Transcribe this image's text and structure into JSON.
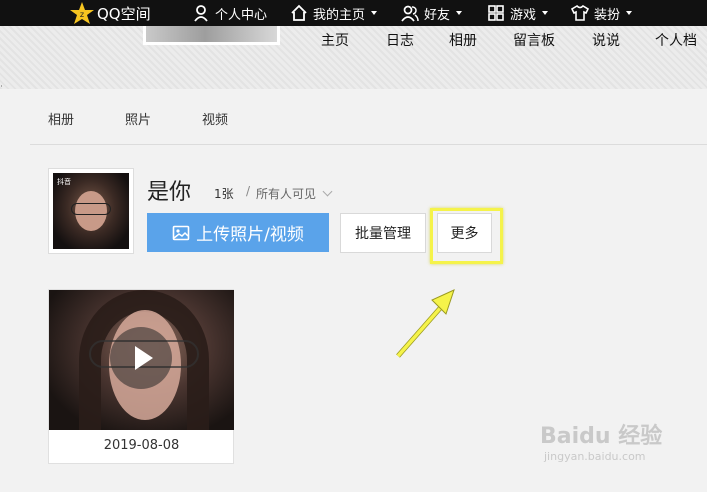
{
  "topbar": {
    "logo_text": "QQ空间",
    "nav": [
      {
        "label": "个人中心",
        "icon": "person-icon"
      },
      {
        "label": "我的主页",
        "icon": "home-icon",
        "has_dropdown": true
      },
      {
        "label": "好友",
        "icon": "friends-icon",
        "has_dropdown": true
      },
      {
        "label": "游戏",
        "icon": "grid-icon",
        "has_dropdown": true
      },
      {
        "label": "装扮",
        "icon": "shirt-icon",
        "has_dropdown": true
      }
    ]
  },
  "space_nav": [
    "主页",
    "日志",
    "相册",
    "留言板",
    "说说",
    "个人档"
  ],
  "edge_char": "ᐧ",
  "album_tabs": [
    "相册",
    "照片",
    "视频"
  ],
  "album": {
    "title": "是你",
    "count": "1张",
    "separator": "/",
    "privacy": "所有人可见",
    "cover_tag": "抖音"
  },
  "buttons": {
    "upload": "上传照片/视频",
    "batch": "批量管理",
    "more": "更多"
  },
  "video": {
    "date": "2019-08-08"
  },
  "watermark": {
    "logo": "Baidu 经验",
    "url": "jingyan.baidu.com"
  },
  "colors": {
    "topbar_bg": "#111111",
    "upload_button": "#5aa3ea",
    "highlight_box": "#f5f34a",
    "arrow": "#f5f34a"
  }
}
